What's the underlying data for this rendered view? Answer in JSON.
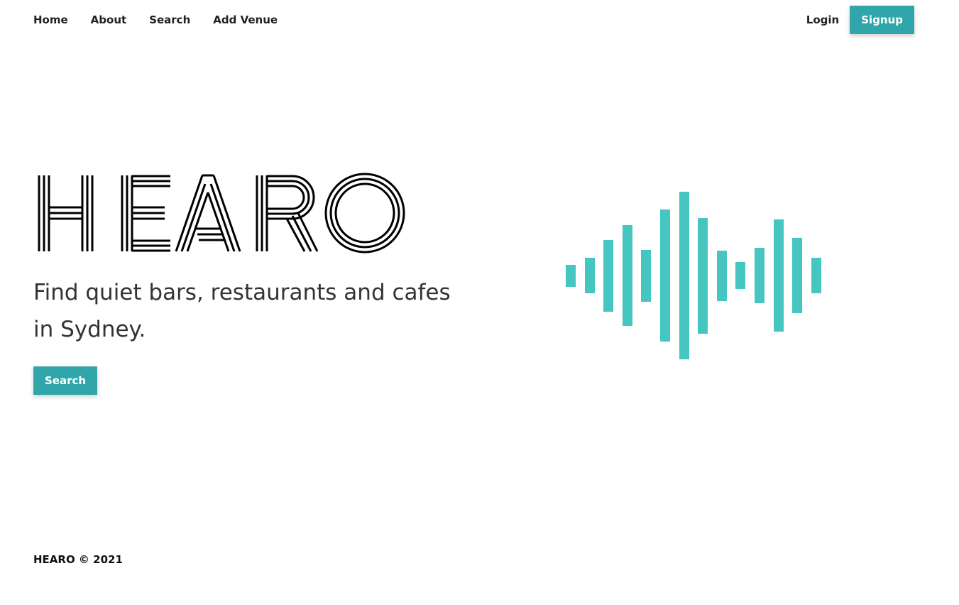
{
  "nav": {
    "links": [
      "Home",
      "About",
      "Search",
      "Add Venue"
    ],
    "login_label": "Login",
    "signup_label": "Signup"
  },
  "hero": {
    "logo_text": "HEARO",
    "tagline": "Find quiet bars, restaurants and cafes in Sydney.",
    "search_label": "Search"
  },
  "wave": {
    "color": "#46c6c0",
    "levels": [
      0.13,
      0.21,
      0.43,
      0.6,
      0.31,
      0.79,
      1.0,
      0.69,
      0.3,
      0.16,
      0.33,
      0.67,
      0.45,
      0.21
    ]
  },
  "footer": {
    "text": "HEARO © 2021"
  },
  "colors": {
    "accent": "#31a6aa",
    "text": "#222222"
  }
}
